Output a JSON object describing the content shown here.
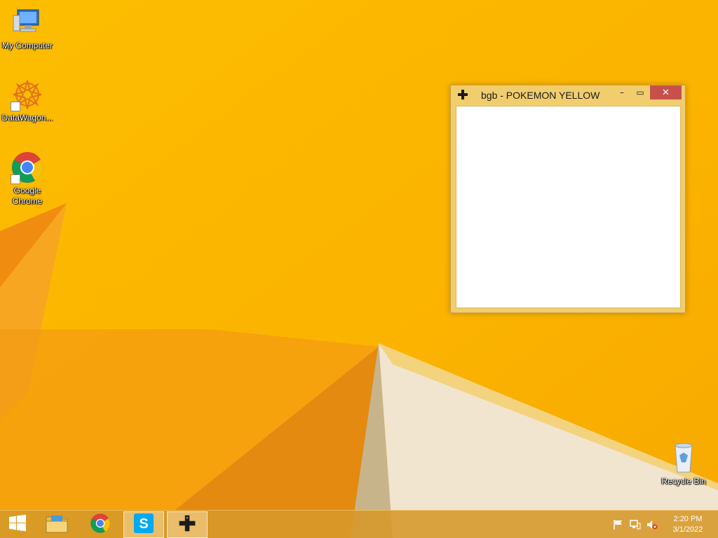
{
  "desktop": {
    "icons": [
      {
        "label": "My Computer",
        "icon": "computer-icon"
      },
      {
        "label": "DataWagon...",
        "icon": "datawagon-icon"
      },
      {
        "label": "Google\nChrome",
        "icon": "chrome-icon"
      },
      {
        "label": "Recycle Bin",
        "icon": "recycle-bin-icon"
      }
    ]
  },
  "window": {
    "title": "bgb - POKEMON YELLOW",
    "icon": "dpad-icon",
    "controls": {
      "minimize": "–",
      "maximize": "▭",
      "close": "✕"
    }
  },
  "taskbar": {
    "items": [
      {
        "name": "start-button",
        "icon": "windows-logo-icon"
      },
      {
        "name": "file-explorer",
        "icon": "folder-icon"
      },
      {
        "name": "chrome",
        "icon": "chrome-icon"
      },
      {
        "name": "skype",
        "icon": "skype-icon",
        "active": true
      },
      {
        "name": "bgb",
        "icon": "dpad-icon",
        "active": true
      }
    ],
    "tray": {
      "icons": [
        "flag-icon",
        "network-icon",
        "volume-muted-icon"
      ],
      "time": "2:20 PM",
      "date": "3/1/2022"
    }
  },
  "colors": {
    "wallpaper": "#fbb800",
    "window_frame": "#f2cd6e",
    "close_button": "#c7504c",
    "taskbar": "#d6982a"
  }
}
